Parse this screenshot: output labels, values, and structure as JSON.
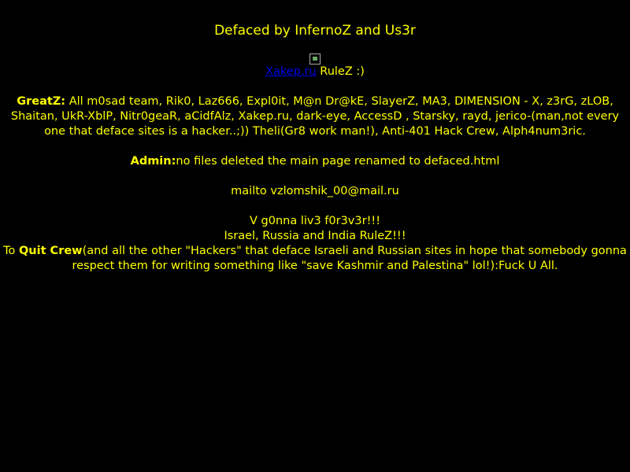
{
  "title": "Defaced by InfernoZ and Us3r",
  "link_line": {
    "link_text": "Xakep.ru",
    "suffix": " RuleZ :)"
  },
  "greatz": {
    "label": "GreatZ:",
    "text": " All m0sad team, Rik0, Laz666, Expl0it, M@n Dr@kE, SlayerZ, MA3, DIMENSION - X, z3rG, zLOB, Shaitan, UkR-XblP, Nitr0geaR, aCidfAlz, Xakep.ru, dark-eye, AccessD , Starsky, rayd, jerico-(man,not every one that deface sites is a hacker..;)) Theli(Gr8 work man!), Anti-401 Hack Crew, Alph4num3ric."
  },
  "admin": {
    "label": "Admin:",
    "text": "no files deleted the main page renamed to defaced.html"
  },
  "mailto": "mailto vzlomshik_00@mail.ru",
  "line_forever": "V g0nna liv3 f0r3v3r!!!",
  "line_rulez": "Israel, Russia and India RuleZ!!!",
  "quit": {
    "prefix": "To ",
    "label": "Quit Crew",
    "text": "(and all the other \"Hackers\" that deface Israeli and Russian sites in hope that somebody gonna respect them for writing something like \"save Kashmir and Palestina\" lol!):Fuck U All."
  },
  "colors": {
    "background": "#000000",
    "text": "#ffff00",
    "link": "#0000ee"
  }
}
